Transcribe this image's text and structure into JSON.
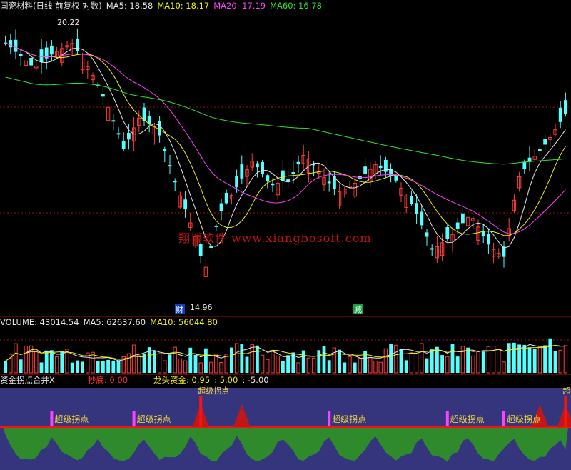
{
  "main_header": {
    "title": "国瓷材料(日线 前复权 对数)",
    "ma5": "MA5: 18.58",
    "ma10": "MA10: 18.17",
    "ma20": "MA20: 17.19",
    "ma60": "MA60: 16.78"
  },
  "volume_header": {
    "label": "VOLUME: 43014.54",
    "ma5": "MA5: 62637.60",
    "ma10": "MA10: 56044.80"
  },
  "indicator_header": {
    "name": "资金拐点合并X",
    "chaodi": "抄底: 0.00",
    "longtou": "龙头资金: 0.95",
    "v1": ": 5.00",
    "v2": ": -5.00"
  },
  "annotations": {
    "high_price": "20.22",
    "low_price": "14.96",
    "low_mark": "财",
    "mid_mark": "减",
    "signal_label": "超级拐点",
    "top_signal_label": "超级拐点"
  },
  "watermark": "翔博软件 www.xiangbosoft.com",
  "colors": {
    "up": "#ff3c3c",
    "down": "#54ffff",
    "ma5": "#e6e6e6",
    "ma10": "#f0f000",
    "ma20": "#ff40ff",
    "ma60": "#30e030",
    "grid": "#a01010",
    "indicator_bg": "#34357c",
    "green_fill": "#2e8a2a",
    "red_line": "#ff1010"
  },
  "chart_data": {
    "type": "candlestick",
    "count": 110,
    "price_range": [
      14.5,
      21.0
    ],
    "high": 20.22,
    "low": 14.96,
    "signal_indices": [
      9,
      25,
      63,
      86,
      97
    ],
    "peak_indices": [
      38,
      46,
      104,
      109
    ]
  }
}
